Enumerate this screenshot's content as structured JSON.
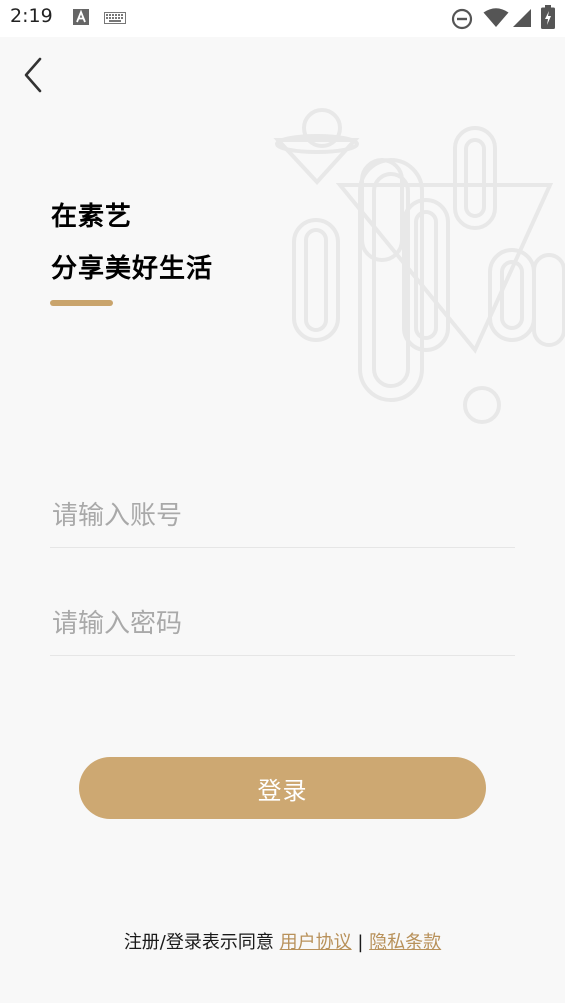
{
  "status_bar": {
    "time": "2:19"
  },
  "icons": {
    "back": "chevron-left-icon",
    "keyboard_notification": "a-box-icon",
    "keyboard": "keyboard-icon",
    "do_not_disturb": "minus-circle-icon",
    "wifi": "wifi-icon",
    "signal": "signal-icon",
    "battery": "battery-charging-icon"
  },
  "header": {
    "line1": "在素艺",
    "line2": "分享美好生活"
  },
  "form": {
    "account_placeholder": "请输入账号",
    "password_placeholder": "请输入密码",
    "login_label": "登录"
  },
  "agreement": {
    "prefix": "注册/登录表示同意",
    "user_agreement": "用户协议",
    "separator": "|",
    "privacy_policy": "隐私条款"
  },
  "colors": {
    "accent": "#c9a46c",
    "button": "#cda872",
    "link": "#b8915a",
    "background": "#f8f8f8"
  }
}
